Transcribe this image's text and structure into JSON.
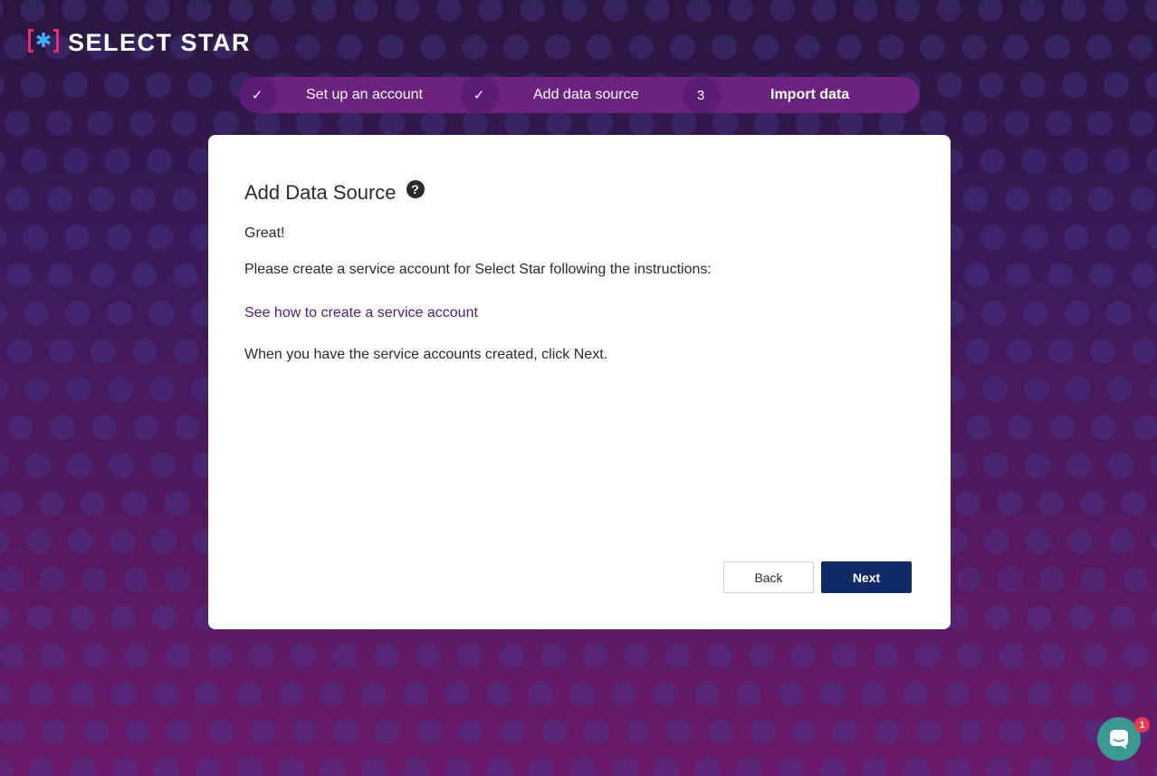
{
  "brand": {
    "name": "SELECT STAR",
    "icon": "bracket-asterisk-logo",
    "accent_pink": "#e6306e",
    "accent_blue": "#3ab0ff"
  },
  "stepper": {
    "steps": [
      {
        "marker": "✓",
        "label": "Set up an account",
        "state": "complete"
      },
      {
        "marker": "✓",
        "label": "Add data source",
        "state": "complete"
      },
      {
        "marker": "3",
        "label": "Import data",
        "state": "current"
      }
    ]
  },
  "card": {
    "title": "Add Data Source",
    "help_icon": "question-circle-icon",
    "greeting": "Great!",
    "instructions": "Please create a service account for Select Star following the instructions:",
    "link_text": "See how to create a service account",
    "next_hint": "When you have the service accounts created, click Next.",
    "back_label": "Back",
    "next_label": "Next"
  },
  "chat": {
    "icon": "chat-bubble-icon",
    "badge": "1"
  },
  "colors": {
    "primary": "#0f2a66",
    "link": "#4a1d8a",
    "chat": "#3a9a92",
    "badge": "#e83a4a"
  }
}
